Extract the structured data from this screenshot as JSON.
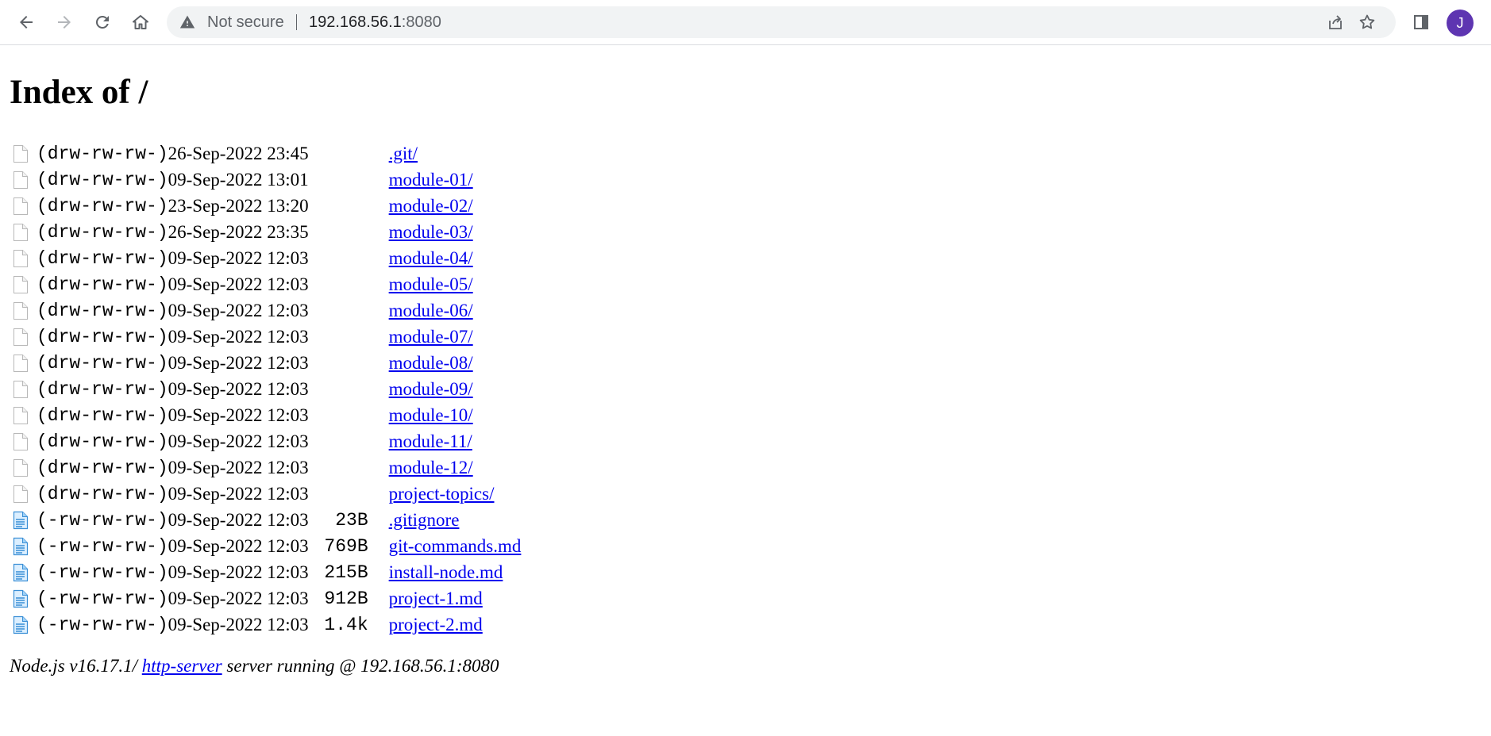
{
  "browser": {
    "security_label": "Not secure",
    "url_host": "192.168.56.1",
    "url_port": ":8080",
    "profile_initial": "J",
    "accent_color": "#5e35b1"
  },
  "page": {
    "title": "Index of /"
  },
  "listing": [
    {
      "type": "dir",
      "perm": "(drw-rw-rw-)",
      "date": "26-Sep-2022 23:45",
      "size": "",
      "name": ".git/"
    },
    {
      "type": "dir",
      "perm": "(drw-rw-rw-)",
      "date": "09-Sep-2022 13:01",
      "size": "",
      "name": "module-01/"
    },
    {
      "type": "dir",
      "perm": "(drw-rw-rw-)",
      "date": "23-Sep-2022 13:20",
      "size": "",
      "name": "module-02/"
    },
    {
      "type": "dir",
      "perm": "(drw-rw-rw-)",
      "date": "26-Sep-2022 23:35",
      "size": "",
      "name": "module-03/"
    },
    {
      "type": "dir",
      "perm": "(drw-rw-rw-)",
      "date": "09-Sep-2022 12:03",
      "size": "",
      "name": "module-04/"
    },
    {
      "type": "dir",
      "perm": "(drw-rw-rw-)",
      "date": "09-Sep-2022 12:03",
      "size": "",
      "name": "module-05/"
    },
    {
      "type": "dir",
      "perm": "(drw-rw-rw-)",
      "date": "09-Sep-2022 12:03",
      "size": "",
      "name": "module-06/"
    },
    {
      "type": "dir",
      "perm": "(drw-rw-rw-)",
      "date": "09-Sep-2022 12:03",
      "size": "",
      "name": "module-07/"
    },
    {
      "type": "dir",
      "perm": "(drw-rw-rw-)",
      "date": "09-Sep-2022 12:03",
      "size": "",
      "name": "module-08/"
    },
    {
      "type": "dir",
      "perm": "(drw-rw-rw-)",
      "date": "09-Sep-2022 12:03",
      "size": "",
      "name": "module-09/"
    },
    {
      "type": "dir",
      "perm": "(drw-rw-rw-)",
      "date": "09-Sep-2022 12:03",
      "size": "",
      "name": "module-10/"
    },
    {
      "type": "dir",
      "perm": "(drw-rw-rw-)",
      "date": "09-Sep-2022 12:03",
      "size": "",
      "name": "module-11/"
    },
    {
      "type": "dir",
      "perm": "(drw-rw-rw-)",
      "date": "09-Sep-2022 12:03",
      "size": "",
      "name": "module-12/"
    },
    {
      "type": "dir",
      "perm": "(drw-rw-rw-)",
      "date": "09-Sep-2022 12:03",
      "size": "",
      "name": "project-topics/"
    },
    {
      "type": "file",
      "perm": "(-rw-rw-rw-)",
      "date": "09-Sep-2022 12:03",
      "size": "23B",
      "name": ".gitignore"
    },
    {
      "type": "file",
      "perm": "(-rw-rw-rw-)",
      "date": "09-Sep-2022 12:03",
      "size": "769B",
      "name": "git-commands.md"
    },
    {
      "type": "file",
      "perm": "(-rw-rw-rw-)",
      "date": "09-Sep-2022 12:03",
      "size": "215B",
      "name": "install-node.md"
    },
    {
      "type": "file",
      "perm": "(-rw-rw-rw-)",
      "date": "09-Sep-2022 12:03",
      "size": "912B",
      "name": "project-1.md"
    },
    {
      "type": "file",
      "perm": "(-rw-rw-rw-)",
      "date": "09-Sep-2022 12:03",
      "size": "1.4k",
      "name": "project-2.md"
    }
  ],
  "footer": {
    "prefix": "Node.js v16.17.1/ ",
    "link": "http-server",
    "suffix": " server running @ 192.168.56.1:8080"
  },
  "colors": {
    "link": "#0000ee",
    "file_icon": "#3a8fd6",
    "folder_icon_outline": "#b8b8b8"
  }
}
